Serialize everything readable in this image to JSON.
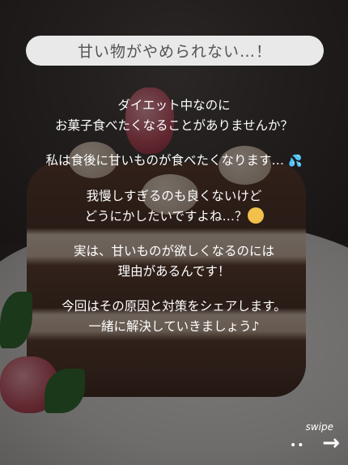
{
  "header": {
    "title": "甘い物がやめられない…！"
  },
  "content": {
    "paragraphs": [
      {
        "lines": [
          "ダイエット中なのに",
          "お菓子食べたくなることがありませんか？"
        ]
      },
      {
        "lines": [
          "私は食後に甘いものが食べたくなります…"
        ],
        "icon": "sweat-drops-icon"
      },
      {
        "lines": [
          "我慢しすぎるのも良くないけど",
          "どうにかしたいですよね…？"
        ],
        "icon": "thinking-face-icon"
      },
      {
        "lines": [
          "実は、甘いものが欲しくなるのには",
          "理由があるんです！"
        ]
      },
      {
        "lines": [
          "今回はその原因と対策をシェアします。",
          "一緒に解決していきましょう♪"
        ]
      }
    ]
  },
  "nav": {
    "swipe_label": "swipe",
    "dots": "••",
    "arrow": "→"
  },
  "colors": {
    "pill_bg": "#e9e9e9",
    "pill_text": "#545454",
    "body_text": "#ffffff",
    "drops": "#69b7ee"
  }
}
